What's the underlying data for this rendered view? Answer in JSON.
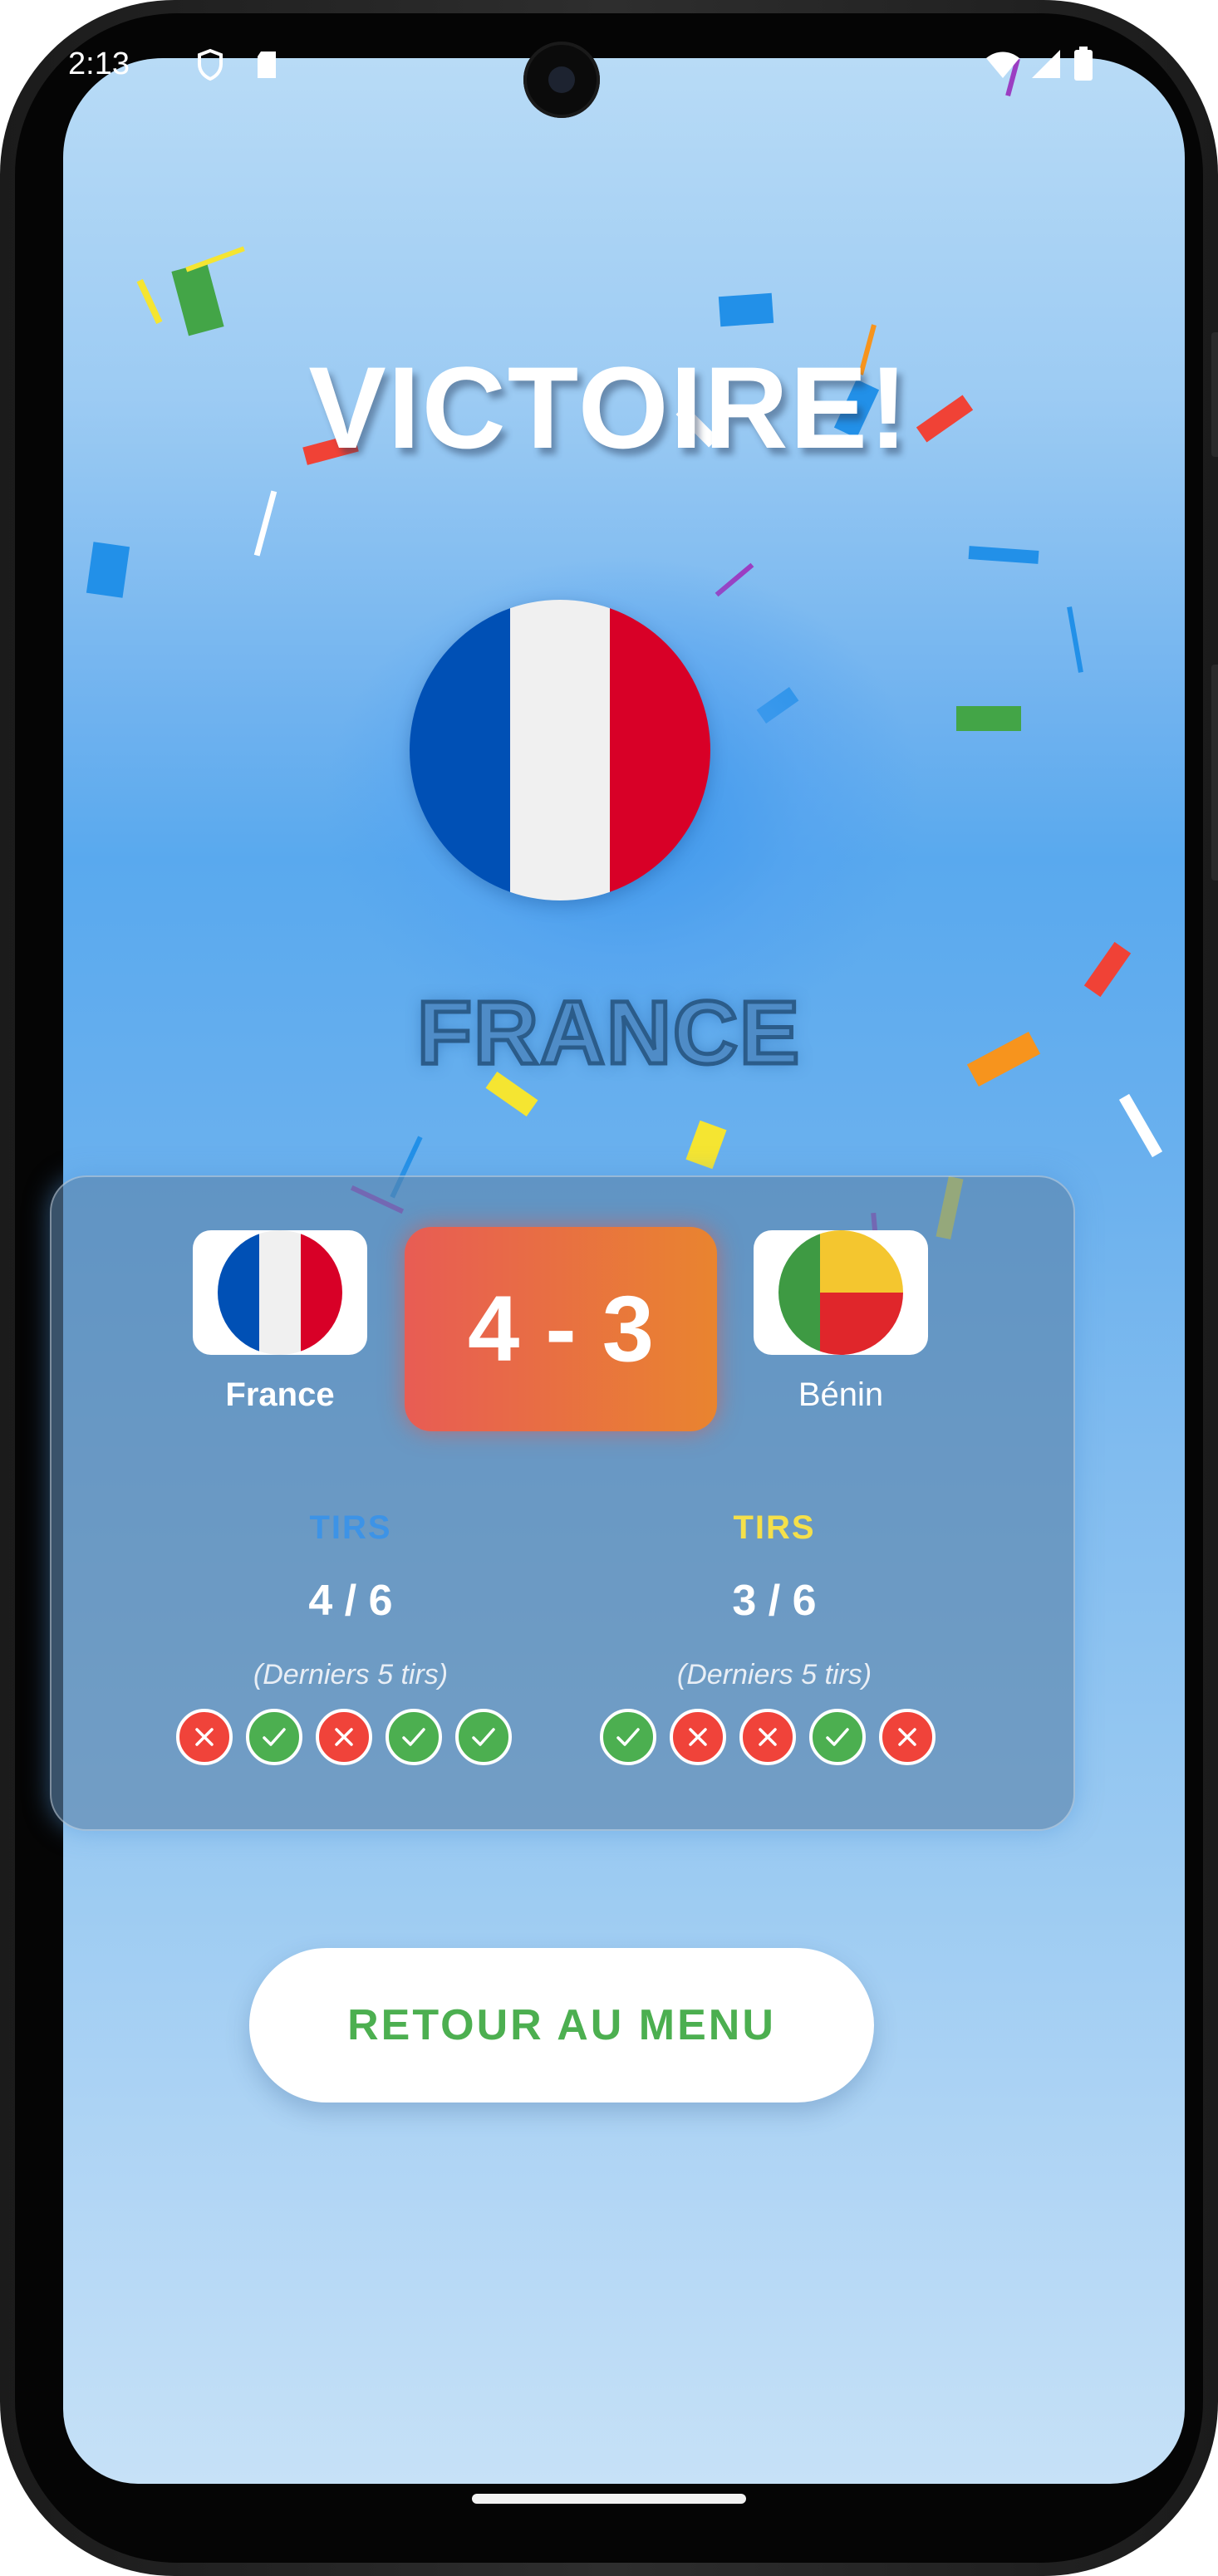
{
  "status_bar": {
    "time": "2:13"
  },
  "screen": {
    "title": "VICTOIRE!",
    "winner_country": "FRANCE"
  },
  "match": {
    "score": "4 - 3",
    "home": {
      "name": "France",
      "shots_label": "TIRS",
      "shots_value": "4 / 6",
      "last_shots_note": "(Derniers 5 tirs)",
      "last_shots": [
        "miss",
        "hit",
        "miss",
        "hit",
        "hit"
      ],
      "label_color": "#3d93e6"
    },
    "away": {
      "name": "Bénin",
      "shots_label": "TIRS",
      "shots_value": "3 / 6",
      "last_shots_note": "(Derniers 5 tirs)",
      "last_shots": [
        "hit",
        "miss",
        "miss",
        "hit",
        "miss"
      ],
      "label_color": "#f5e04a"
    }
  },
  "actions": {
    "back_to_menu": "RETOUR AU MENU"
  },
  "colors": {
    "france_blue": "#0050b5",
    "france_white": "#f0f0f0",
    "france_red": "#d80027",
    "benin_green": "#3e9a43",
    "benin_yellow": "#f4c62f",
    "benin_red": "#e0262b",
    "hit": "#4caf50",
    "miss": "#f0433a",
    "score_gradient_start": "#e85c54",
    "score_gradient_end": "#e9842f"
  },
  "icons": {
    "hit": "check-icon",
    "miss": "cross-icon"
  }
}
